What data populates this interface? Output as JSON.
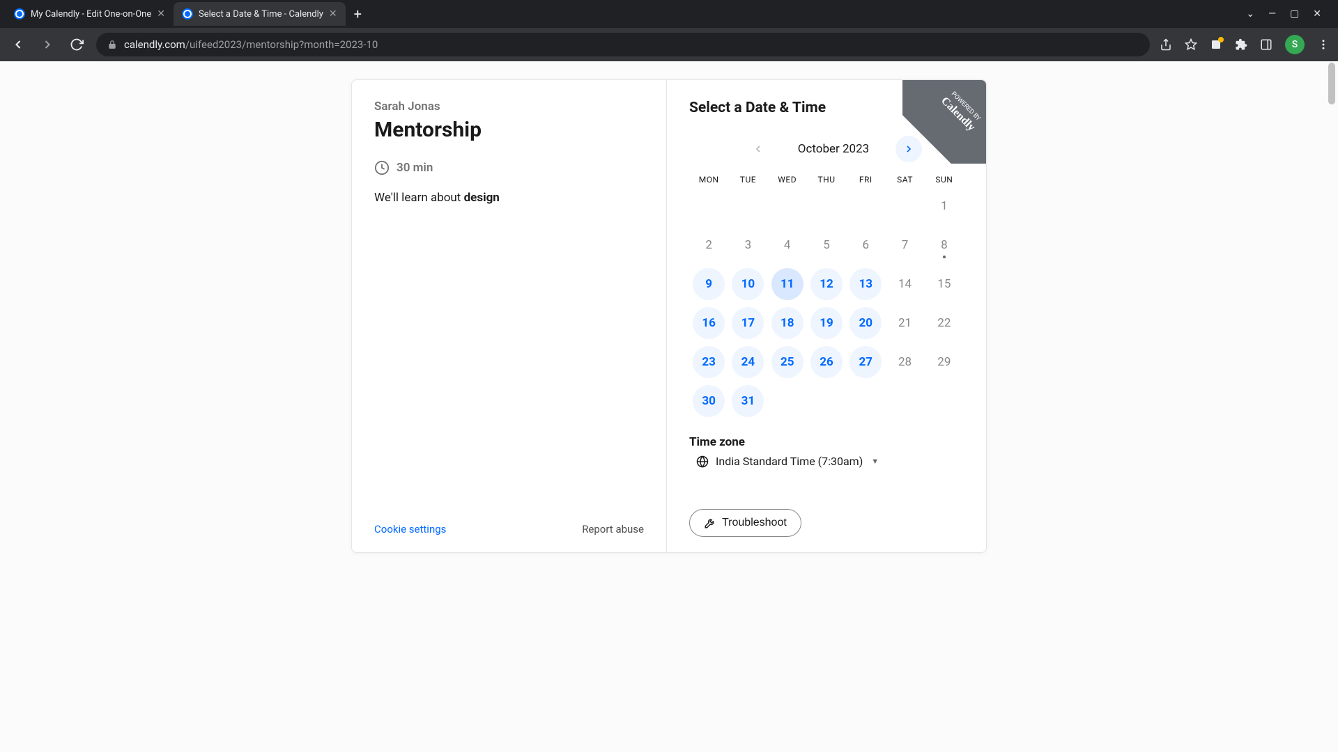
{
  "browser": {
    "tabs": [
      {
        "title": "My Calendly - Edit One-on-One"
      },
      {
        "title": "Select a Date & Time - Calendly"
      }
    ],
    "url_host": "calendly.com",
    "url_path": "/uifeed2023/mentorship?month=2023-10",
    "avatar_initial": "S"
  },
  "left": {
    "host": "Sarah Jonas",
    "title": "Mentorship",
    "duration": "30 min",
    "desc_prefix": "We'll learn about ",
    "desc_bold": "design",
    "cookie": "Cookie settings",
    "report": "Report abuse"
  },
  "right": {
    "heading": "Select a Date & Time",
    "month": "October 2023",
    "dow": [
      "MON",
      "TUE",
      "WED",
      "THU",
      "FRI",
      "SAT",
      "SUN"
    ],
    "tz_label": "Time zone",
    "tz_value": "India Standard Time (7:30am)",
    "troubleshoot": "Troubleshoot",
    "powered_small": "POWERED BY",
    "powered_brand": "Calendly"
  },
  "calendar": {
    "leading_blanks": 6,
    "days": [
      {
        "n": "1",
        "avail": false,
        "today": false
      },
      {
        "n": "2",
        "avail": false,
        "today": false
      },
      {
        "n": "3",
        "avail": false,
        "today": false
      },
      {
        "n": "4",
        "avail": false,
        "today": false
      },
      {
        "n": "5",
        "avail": false,
        "today": false
      },
      {
        "n": "6",
        "avail": false,
        "today": false
      },
      {
        "n": "7",
        "avail": false,
        "today": false
      },
      {
        "n": "8",
        "avail": false,
        "today": true
      },
      {
        "n": "9",
        "avail": true,
        "today": false
      },
      {
        "n": "10",
        "avail": true,
        "today": false
      },
      {
        "n": "11",
        "avail": true,
        "today": false,
        "hover": true
      },
      {
        "n": "12",
        "avail": true,
        "today": false
      },
      {
        "n": "13",
        "avail": true,
        "today": false
      },
      {
        "n": "14",
        "avail": false,
        "today": false
      },
      {
        "n": "15",
        "avail": false,
        "today": false
      },
      {
        "n": "16",
        "avail": true,
        "today": false
      },
      {
        "n": "17",
        "avail": true,
        "today": false
      },
      {
        "n": "18",
        "avail": true,
        "today": false
      },
      {
        "n": "19",
        "avail": true,
        "today": false
      },
      {
        "n": "20",
        "avail": true,
        "today": false
      },
      {
        "n": "21",
        "avail": false,
        "today": false
      },
      {
        "n": "22",
        "avail": false,
        "today": false
      },
      {
        "n": "23",
        "avail": true,
        "today": false
      },
      {
        "n": "24",
        "avail": true,
        "today": false
      },
      {
        "n": "25",
        "avail": true,
        "today": false
      },
      {
        "n": "26",
        "avail": true,
        "today": false
      },
      {
        "n": "27",
        "avail": true,
        "today": false
      },
      {
        "n": "28",
        "avail": false,
        "today": false
      },
      {
        "n": "29",
        "avail": false,
        "today": false
      },
      {
        "n": "30",
        "avail": true,
        "today": false
      },
      {
        "n": "31",
        "avail": true,
        "today": false
      }
    ]
  }
}
